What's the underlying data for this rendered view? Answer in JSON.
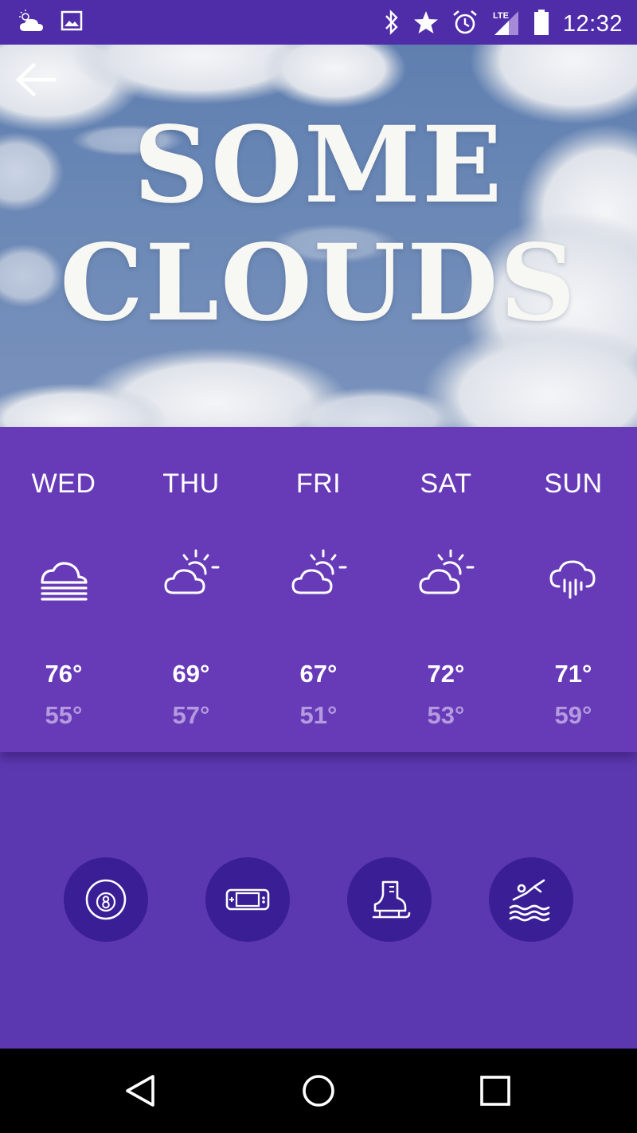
{
  "status_bar": {
    "time": "12:32",
    "left_icons": [
      "weather-cloud-icon",
      "image-icon"
    ],
    "right_icons": [
      "bluetooth-icon",
      "star-icon",
      "alarm-icon",
      "lte-signal-icon",
      "battery-icon"
    ],
    "network_label": "LTE"
  },
  "hero": {
    "title": "SOME\nCLOUDS",
    "background": "cloudy-sky"
  },
  "forecast": {
    "days": [
      {
        "day": "WED",
        "icon": "fog-icon",
        "high": "76°",
        "low": "55°"
      },
      {
        "day": "THU",
        "icon": "partly-cloudy-icon",
        "high": "69°",
        "low": "57°"
      },
      {
        "day": "FRI",
        "icon": "partly-cloudy-icon",
        "high": "67°",
        "low": "51°"
      },
      {
        "day": "SAT",
        "icon": "partly-cloudy-icon",
        "high": "72°",
        "low": "53°"
      },
      {
        "day": "SUN",
        "icon": "rain-icon",
        "high": "71°",
        "low": "59°"
      }
    ]
  },
  "activities": [
    {
      "name": "billiards",
      "icon": "eight-ball-icon"
    },
    {
      "name": "gaming",
      "icon": "handheld-console-icon"
    },
    {
      "name": "ice-skating",
      "icon": "ice-skate-icon"
    },
    {
      "name": "swimming",
      "icon": "swimmer-icon"
    }
  ],
  "colors": {
    "status_bar": "#4f2ca8",
    "forecast_bg": "#673ab7",
    "activities_bg": "#5c38b0",
    "activity_circle": "#3a1e96",
    "low_temp": "#b59ae0"
  }
}
